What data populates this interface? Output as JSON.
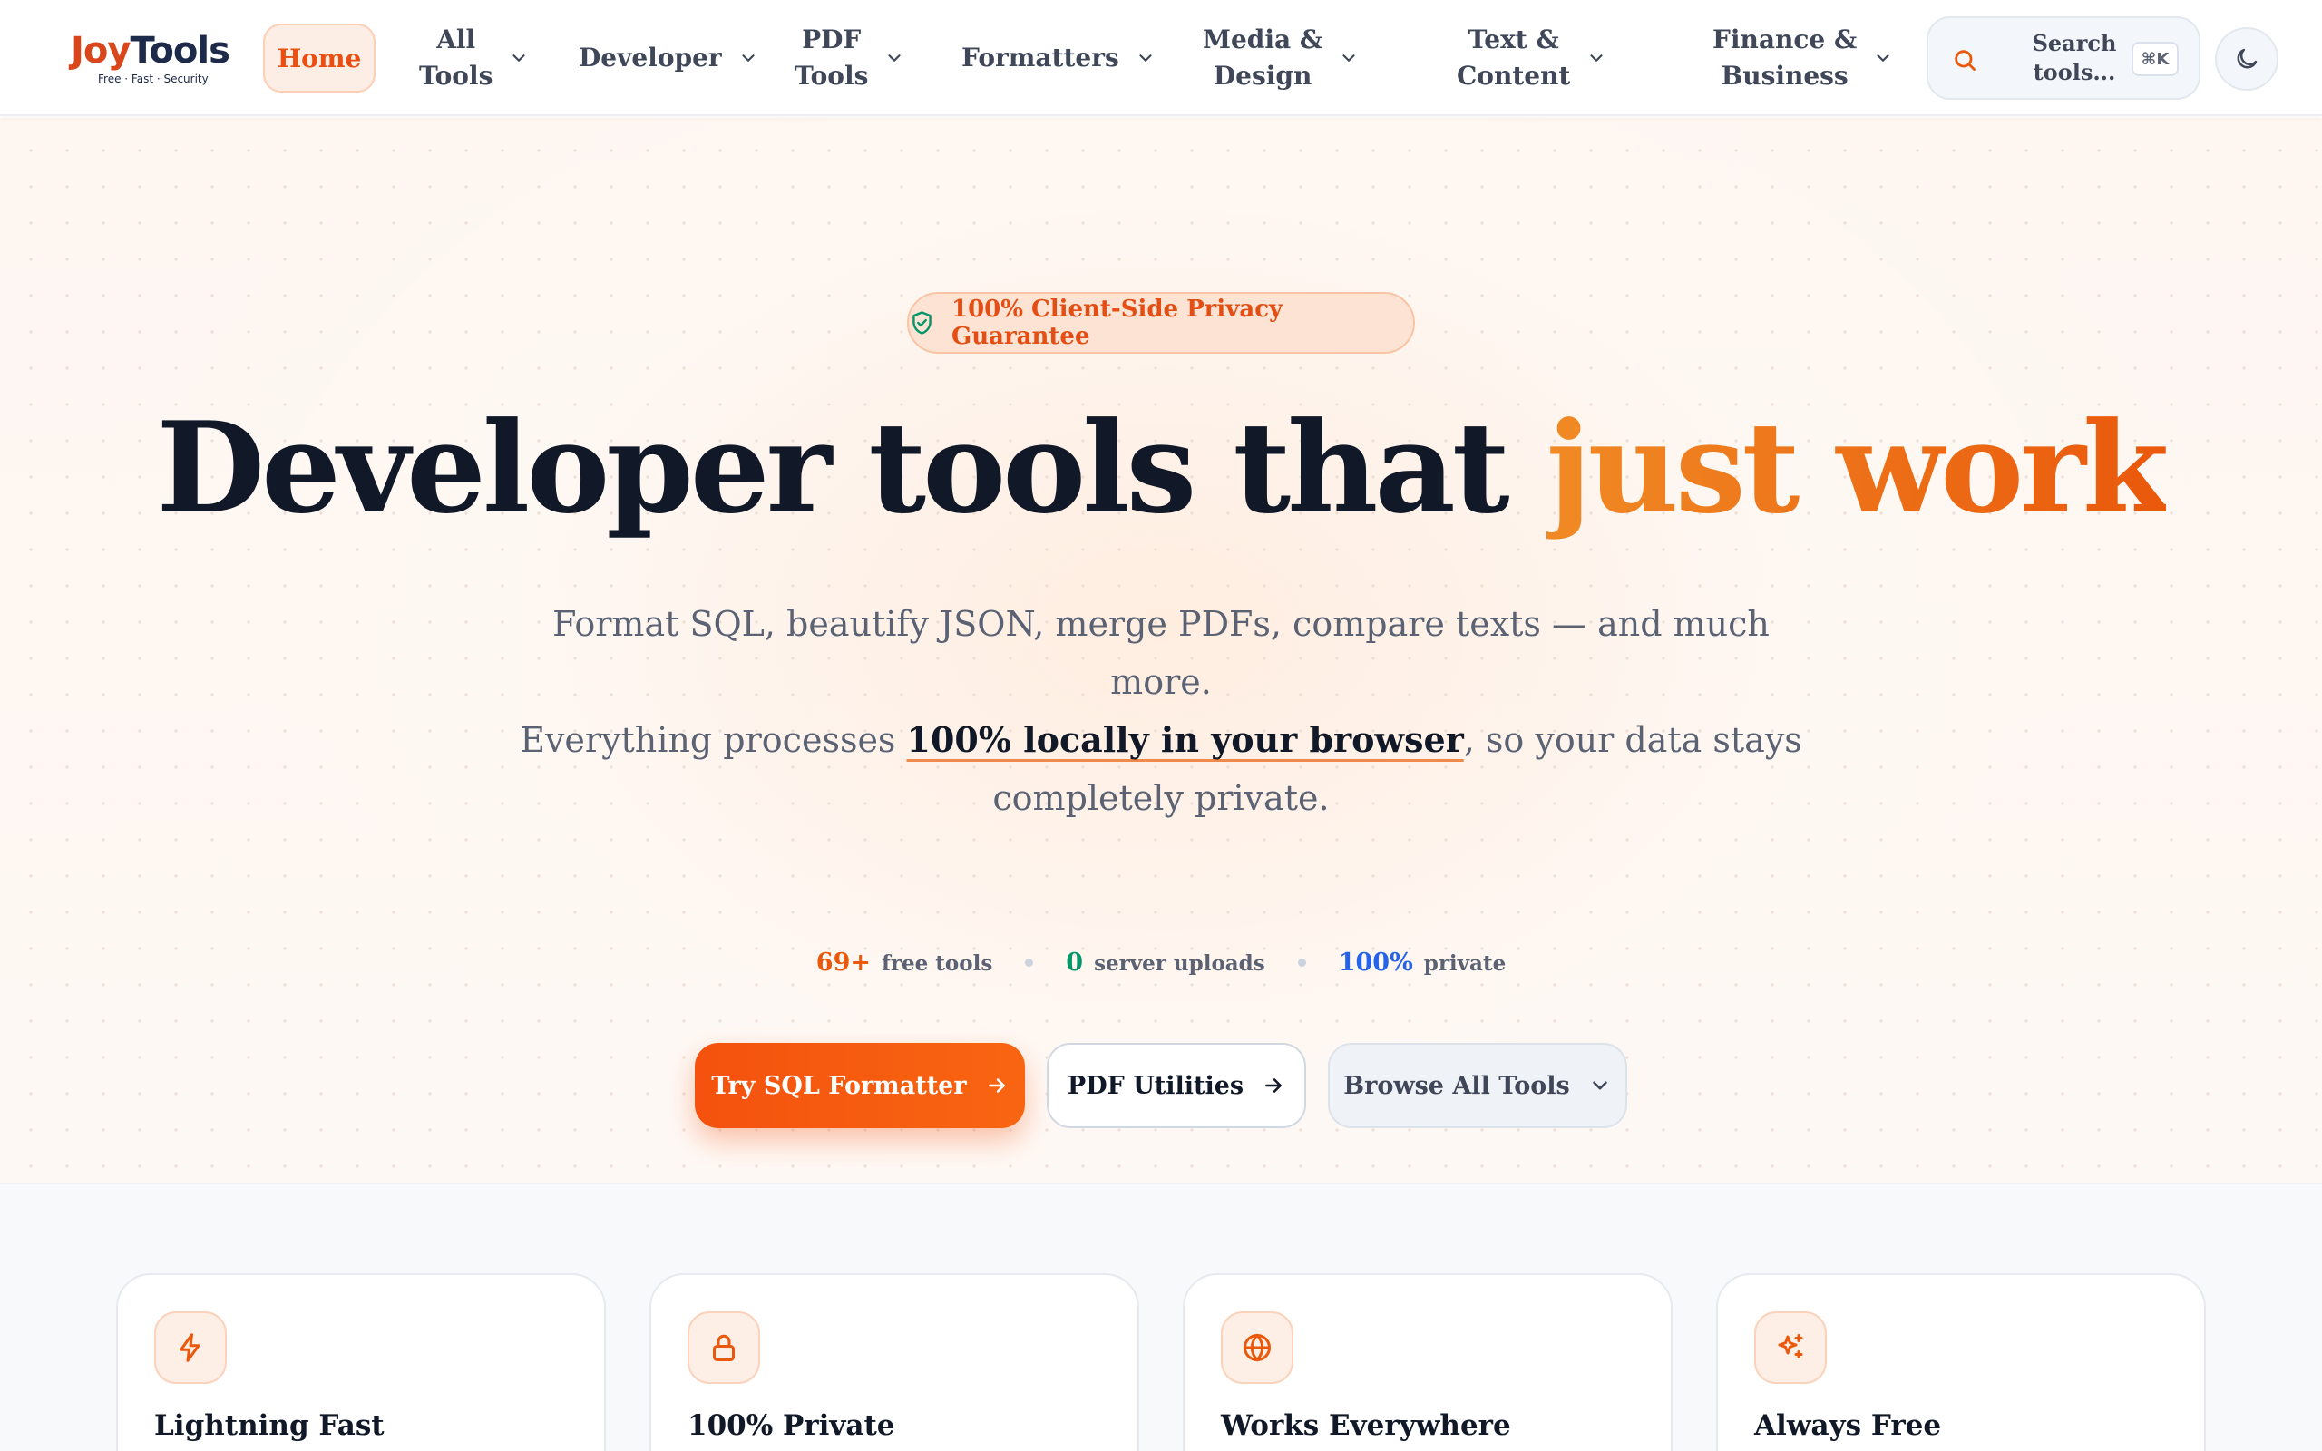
{
  "brand": {
    "name_part1": "Joy",
    "name_part2": "Tools",
    "tagline": "Free · Fast · Security",
    "accent_color": "#f4520e"
  },
  "nav": {
    "home": "Home",
    "items": [
      {
        "label": "All\nTools",
        "icon": "chevron-down-icon"
      },
      {
        "label": "Developer",
        "icon": "chevron-down-icon"
      },
      {
        "label": "PDF\nTools",
        "icon": "chevron-down-icon"
      },
      {
        "label": "Formatters",
        "icon": "chevron-down-icon"
      },
      {
        "label": "Media &\nDesign",
        "icon": "chevron-down-icon"
      },
      {
        "label": "Text &\nContent",
        "icon": "chevron-down-icon"
      },
      {
        "label": "Finance &\nBusiness",
        "icon": "chevron-down-icon"
      }
    ],
    "search": {
      "label": "Search\ntools...",
      "shortcut": "⌘K"
    },
    "theme_toggle_icon": "moon-icon"
  },
  "hero": {
    "badge": "100% Client-Side Privacy Guarantee",
    "title_main": "Developer tools that ",
    "title_accent": "just work",
    "subtitle_line1": "Format SQL, beautify JSON, merge PDFs, compare texts — and much more.",
    "subtitle_pre": "Everything processes ",
    "subtitle_highlight": "100% locally in your browser",
    "subtitle_post": ", so your data stays completely private.",
    "stats": [
      {
        "value": "69+",
        "label": "free tools",
        "color": "#ea580c"
      },
      {
        "value": "0",
        "label": "server uploads",
        "color": "#059669"
      },
      {
        "value": "100%",
        "label": "private",
        "color": "#2563eb"
      }
    ],
    "buttons": {
      "primary": "Try SQL Formatter",
      "secondary": "PDF Utilities",
      "tertiary": "Browse All Tools"
    }
  },
  "features": [
    {
      "title": "Lightning Fast",
      "icon": "lightning-icon"
    },
    {
      "title": "100% Private",
      "icon": "lock-icon"
    },
    {
      "title": "Works Everywhere",
      "icon": "globe-icon"
    },
    {
      "title": "Always Free",
      "icon": "sparkles-icon"
    }
  ]
}
